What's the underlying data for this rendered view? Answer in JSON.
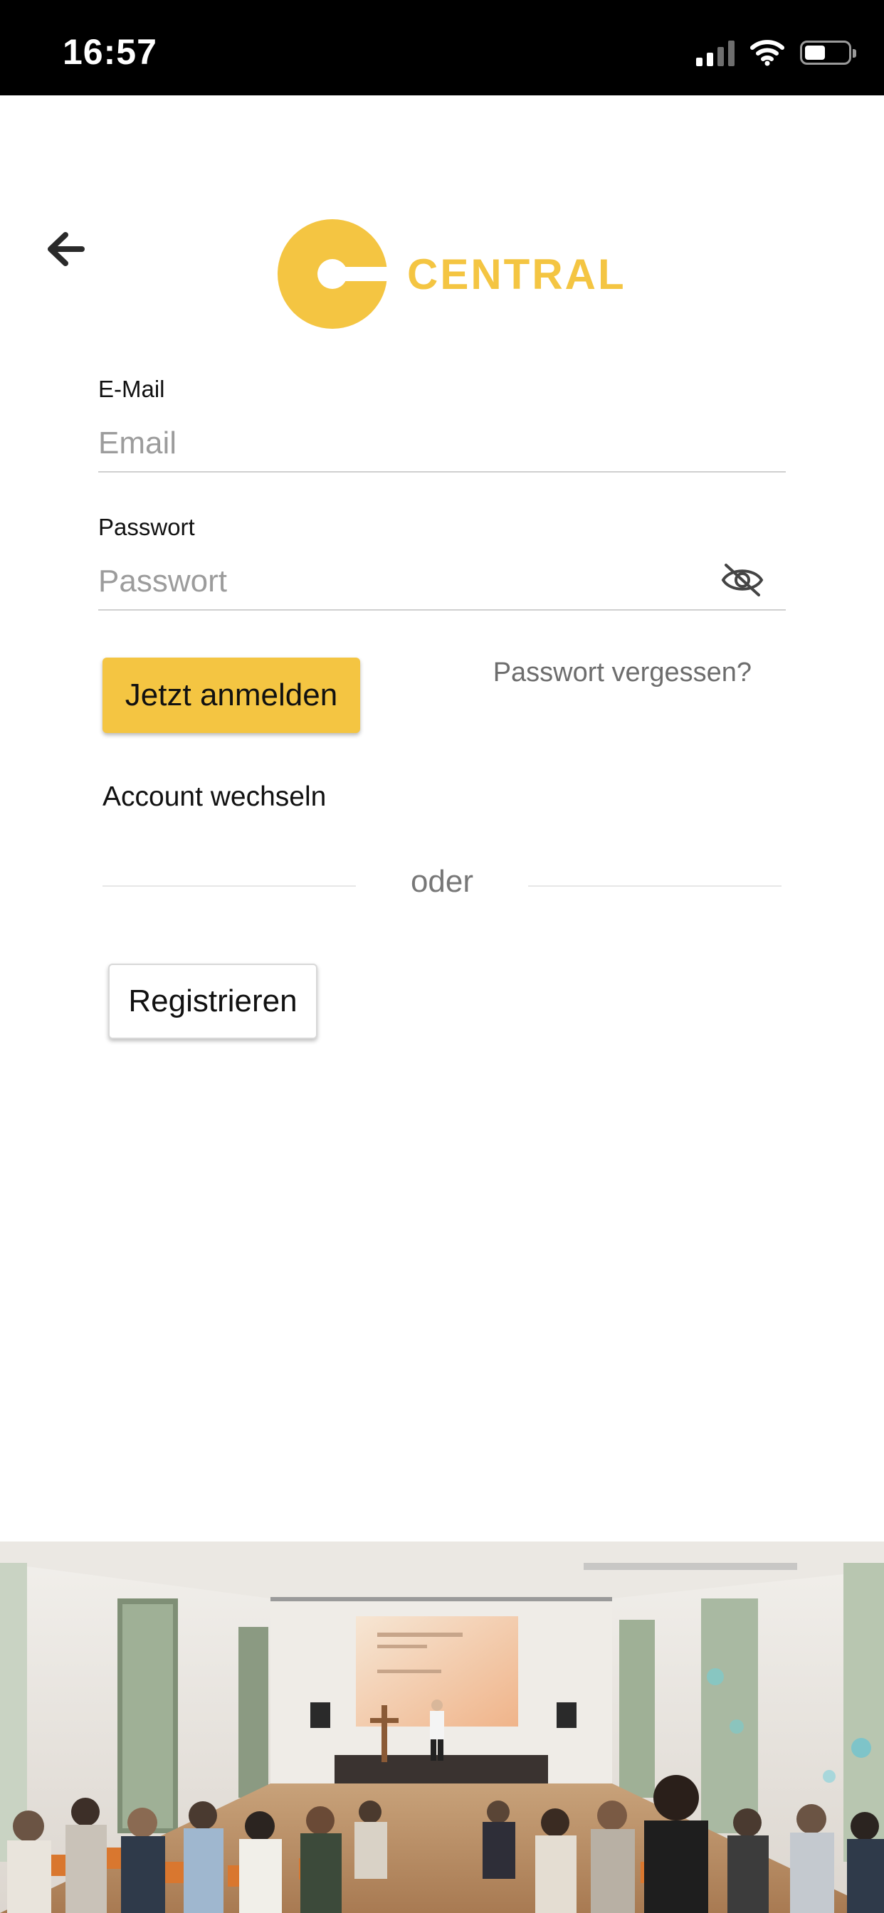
{
  "status_bar": {
    "time": "16:57"
  },
  "brand": {
    "name": "CENTRAL",
    "accent_color": "#f4c542"
  },
  "icons": {
    "back": "arrow-left-icon",
    "password_toggle": "eye-off-icon",
    "signal": "cellular-signal-icon",
    "wifi": "wifi-icon",
    "battery": "battery-icon"
  },
  "form": {
    "email": {
      "label": "E-Mail",
      "placeholder": "Email",
      "value": ""
    },
    "password": {
      "label": "Passwort",
      "placeholder": "Passwort",
      "value": ""
    },
    "login_button": "Jetzt anmelden",
    "forgot_password": "Passwort vergessen?",
    "switch_account": "Account wechseln",
    "divider": "oder",
    "register_button": "Registrieren"
  }
}
